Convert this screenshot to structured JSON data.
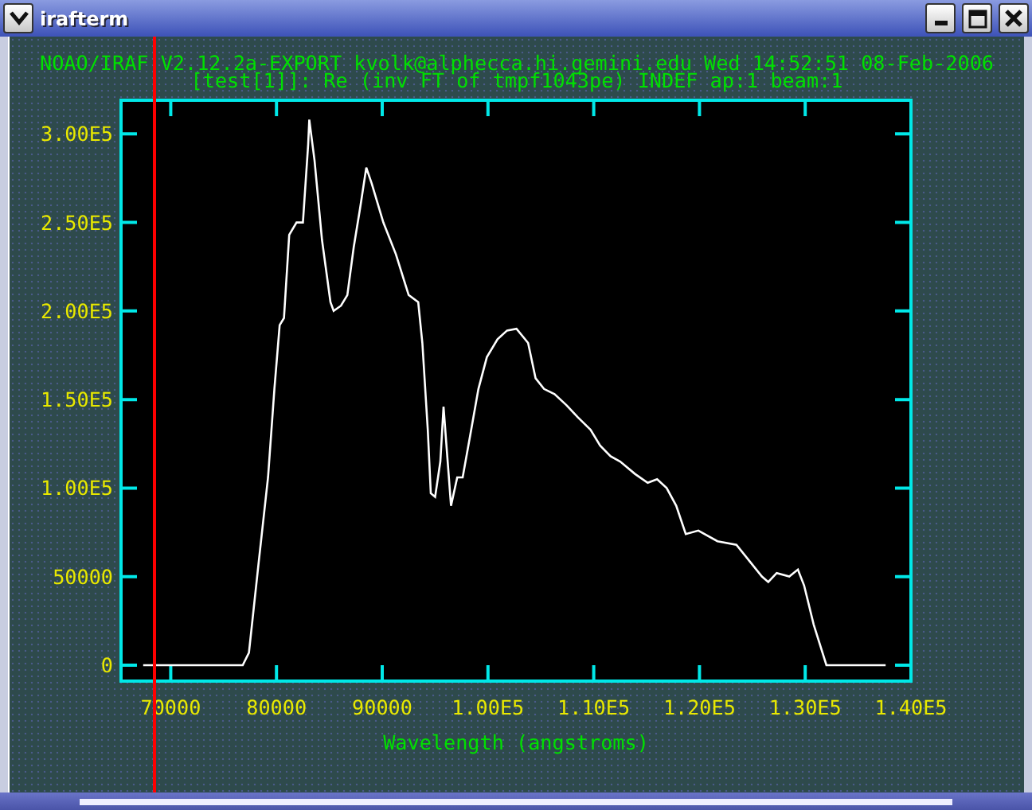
{
  "window": {
    "title": "irafterm"
  },
  "plot": {
    "header": "NOAO/IRAF V2.12.2a-EXPORT kvolk@alphecca.hi.gemini.edu Wed 14:52:51 08-Feb-2006",
    "chart_data": {
      "type": "line",
      "title": "[test[1]]: Re (inv FT of tmpf1043pe) INDEF ap:1 beam:1",
      "xlabel": "Wavelength (angstroms)",
      "xlim": [
        65300,
        140000
      ],
      "ylim": [
        -9000,
        319000
      ],
      "xticks": [
        {
          "value": 70000,
          "label": "70000"
        },
        {
          "value": 80000,
          "label": "80000"
        },
        {
          "value": 90000,
          "label": "90000"
        },
        {
          "value": 100000,
          "label": "1.00E5"
        },
        {
          "value": 110000,
          "label": "1.10E5"
        },
        {
          "value": 120000,
          "label": "1.20E5"
        },
        {
          "value": 130000,
          "label": "1.30E5"
        },
        {
          "value": 140000,
          "label": "1.40E5"
        }
      ],
      "yticks": [
        {
          "value": 0,
          "label": "0"
        },
        {
          "value": 50000,
          "label": "50000"
        },
        {
          "value": 100000,
          "label": "1.00E5"
        },
        {
          "value": 150000,
          "label": "1.50E5"
        },
        {
          "value": 200000,
          "label": "2.00E5"
        },
        {
          "value": 250000,
          "label": "2.50E5"
        },
        {
          "value": 300000,
          "label": "3.00E5"
        }
      ],
      "x": [
        67400,
        76800,
        77400,
        78300,
        79200,
        79800,
        80300,
        80700,
        81200,
        81900,
        82500,
        83000,
        83100,
        83600,
        84300,
        85100,
        85400,
        86100,
        86700,
        87300,
        87900,
        88500,
        89000,
        90100,
        91300,
        92500,
        93400,
        93800,
        94300,
        94600,
        95000,
        95500,
        95800,
        96100,
        96500,
        97100,
        97600,
        98300,
        99100,
        99900,
        100900,
        101800,
        102700,
        103800,
        104500,
        105300,
        106300,
        107400,
        108500,
        109700,
        110600,
        111600,
        112500,
        113900,
        115100,
        116000,
        116900,
        117800,
        118700,
        119900,
        121700,
        123500,
        124700,
        125900,
        126500,
        127300,
        128500,
        129300,
        129900,
        130800,
        132000,
        137600
      ],
      "series": [
        {
          "color": "#ffffff",
          "values": [
            0,
            0,
            7000,
            57000,
            106000,
            156000,
            192000,
            196000,
            243000,
            250000,
            250000,
            294000,
            308000,
            285000,
            240000,
            205000,
            200000,
            203000,
            209000,
            236000,
            258000,
            281000,
            272000,
            250000,
            232000,
            209000,
            205000,
            182000,
            133000,
            97000,
            95000,
            115000,
            146000,
            122000,
            90000,
            106000,
            106000,
            129000,
            156000,
            174000,
            184000,
            189000,
            190000,
            182000,
            162000,
            156000,
            153000,
            147000,
            140000,
            133000,
            124000,
            118000,
            115000,
            108000,
            103000,
            105000,
            100000,
            90000,
            74000,
            76000,
            70000,
            68000,
            59000,
            50000,
            47000,
            52000,
            50000,
            54000,
            45000,
            23000,
            0,
            0
          ]
        }
      ]
    }
  }
}
